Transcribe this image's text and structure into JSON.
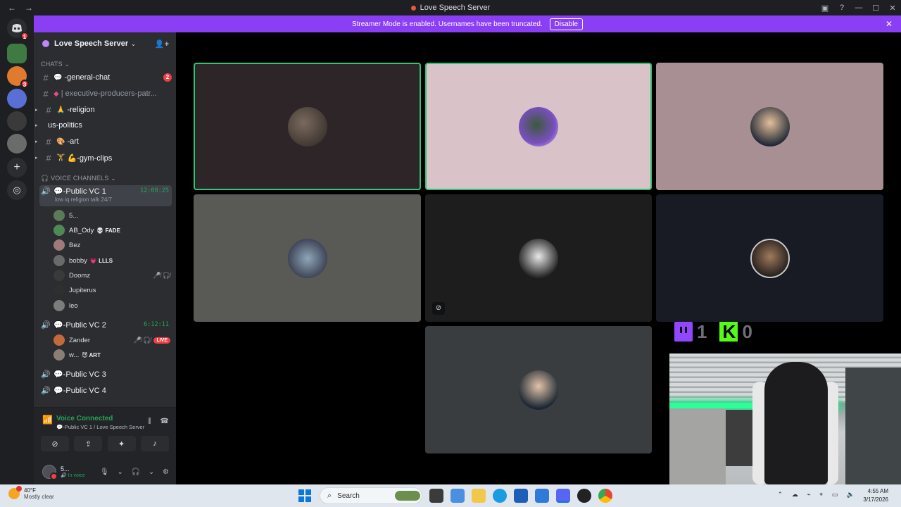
{
  "window": {
    "title": "Love Speech Server",
    "nav_back": "←",
    "nav_forward": "→"
  },
  "banner": {
    "text": "Streamer Mode is enabled. Usernames have been truncated.",
    "button": "Disable",
    "close": "✕"
  },
  "server": {
    "name": "Love Speech Server",
    "chevron": "⌄"
  },
  "categories": {
    "chats": "CHATS ⌄",
    "voice": "🎧 VOICE CHANNELS ⌄"
  },
  "text_channels": [
    {
      "emoji": "💬",
      "name": "-general-chat",
      "mentions": "2"
    },
    {
      "emoji": "◆",
      "name": "| executive-producers-patr..."
    },
    {
      "emoji": "🙏",
      "name": "-religion"
    },
    {
      "emoji": "",
      "name": "us-politics"
    },
    {
      "emoji": "🎨",
      "name": "-art"
    },
    {
      "emoji": "🏋",
      "name": "💪-gym-clips"
    }
  ],
  "voice_channels": [
    {
      "name": "💬-Public VC 1",
      "timer": "12:08:25",
      "subtitle": "low iq religion talk 24/7",
      "members": [
        {
          "name": "5...",
          "tag": "",
          "icons": ""
        },
        {
          "name": "AB_Ody",
          "tag": "💀 FADE",
          "icons": ""
        },
        {
          "name": "Bez",
          "tag": "",
          "icons": ""
        },
        {
          "name": "bobby",
          "tag": "💗 LLLS",
          "icons": ""
        },
        {
          "name": "Doomz",
          "tag": "",
          "icons": "🎤̸ 🎧̸"
        },
        {
          "name": "Jupiterus",
          "tag": "",
          "icons": ""
        },
        {
          "name": "leo",
          "tag": "",
          "icons": ""
        }
      ]
    },
    {
      "name": "💬-Public VC 2",
      "timer": "6:12:11",
      "members": [
        {
          "name": "Zander",
          "tag": "",
          "icons": "🎤̸ 🎧̸",
          "live": "LIVE"
        },
        {
          "name": "w...",
          "tag": "😈 ART",
          "icons": ""
        }
      ]
    },
    {
      "name": "💬-Public VC 3"
    },
    {
      "name": "💬-Public VC 4"
    }
  ],
  "voice_panel": {
    "status": "Voice Connected",
    "location": "💬-Public VC 1 / Love Speech Server"
  },
  "user_panel": {
    "name": "5...",
    "status": "🔊 In voice"
  },
  "counters": {
    "twitch": "1",
    "kick": "0"
  },
  "taskbar": {
    "temperature": "40°F",
    "weather": "Mostly clear",
    "search_placeholder": "Search",
    "time": "4:55 AM",
    "date": "3/17/2026"
  },
  "colors": {
    "banner": "#8b3ff5",
    "speaking_border": "#2dc770",
    "sidebar": "#2b2d31",
    "rail": "#1e1f22",
    "twitch": "#9146ff",
    "kick": "#53fc18"
  },
  "icons": {
    "discord_home": "discord-icon",
    "add_server": "plus-icon",
    "explore": "compass-icon"
  }
}
